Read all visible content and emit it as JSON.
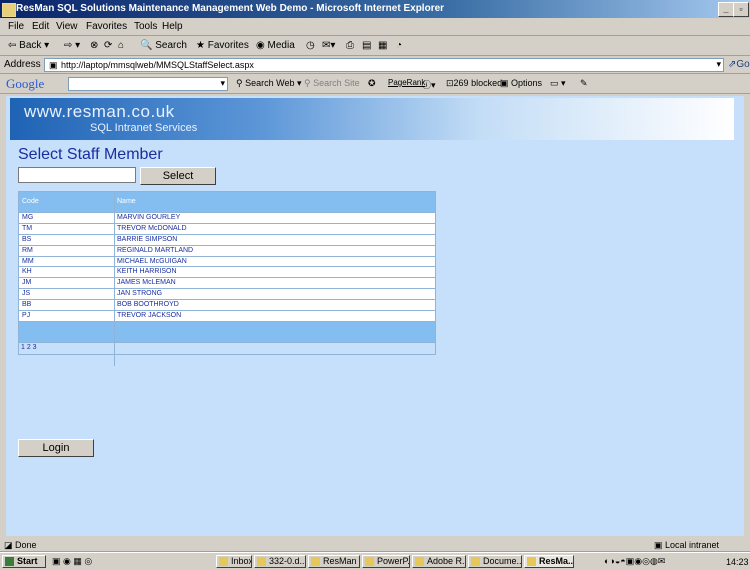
{
  "window": {
    "title": "ResMan SQL Solutions Maintenance Management Web Demo - Microsoft Internet Explorer"
  },
  "menu": [
    "File",
    "Edit",
    "View",
    "Favorites",
    "Tools",
    "Help"
  ],
  "toolbar": {
    "back": "Back",
    "search": "Search",
    "favorites": "Favorites",
    "media": "Media"
  },
  "address": {
    "label": "Address",
    "url": "http://laptop/mmsqlweb/MMSQLStaffSelect.aspx",
    "go": "Go"
  },
  "googlebar": {
    "logo": "Google",
    "search_web": "Search Web",
    "search_site": "Search Site",
    "pagerank": "PageRank",
    "blocked": "269 blocked",
    "options": "Options"
  },
  "page": {
    "banner": {
      "site": "www.resman.co.uk",
      "tagline": "SQL Intranet Services"
    },
    "heading": "Select Staff Member",
    "select_button": "Select",
    "grid": {
      "headers": {
        "code": "Code",
        "name": "Name"
      },
      "rows": [
        {
          "code": "MG",
          "name": "MARVIN GOURLEY"
        },
        {
          "code": "TM",
          "name": "TREVOR McDONALD"
        },
        {
          "code": "BS",
          "name": "BARRIE SIMPSON"
        },
        {
          "code": "RM",
          "name": "REGINALD MARTLAND"
        },
        {
          "code": "MM",
          "name": "MICHAEL McGUIGAN"
        },
        {
          "code": "KH",
          "name": "KEITH HARRISON"
        },
        {
          "code": "JM",
          "name": "JAMES McLEMAN"
        },
        {
          "code": "JS",
          "name": "JAN STRONG"
        },
        {
          "code": "BB",
          "name": "BOB BOOTHROYD"
        },
        {
          "code": "PJ",
          "name": "TREVOR JACKSON"
        }
      ],
      "pager": "1 2 3"
    },
    "login_button": "Login"
  },
  "status": {
    "left": "Done",
    "zone": "Local intranet"
  },
  "taskbar": {
    "start": "Start",
    "items": [
      "Inbox - ...",
      "332-0.d...",
      "ResMan ...",
      "PowerP...",
      "Adobe R...",
      "Docume...",
      "ResMa..."
    ],
    "clock": "14:23"
  }
}
